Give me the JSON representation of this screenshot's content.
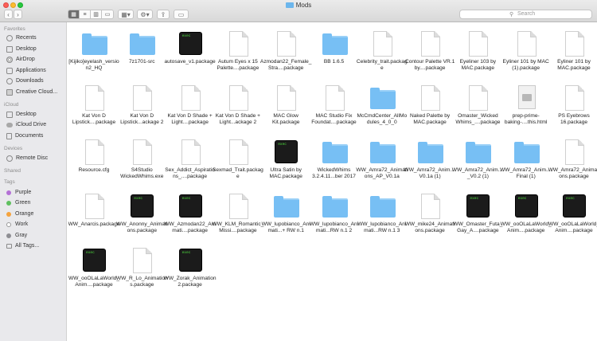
{
  "window": {
    "title": "Mods"
  },
  "toolbar": {
    "back_icon": "chevron-left-icon",
    "forward_icon": "chevron-right-icon",
    "view_modes": [
      "icon",
      "list",
      "columns",
      "gallery"
    ],
    "search_placeholder": "Search"
  },
  "sidebar": {
    "favorites_heading": "Favorites",
    "favorites": [
      {
        "label": "Recents",
        "icon": "clock-icon"
      },
      {
        "label": "Desktop",
        "icon": "desktop-icon"
      },
      {
        "label": "AirDrop",
        "icon": "airdrop-icon"
      },
      {
        "label": "Applications",
        "icon": "applications-icon"
      },
      {
        "label": "Downloads",
        "icon": "downloads-icon"
      },
      {
        "label": "Creative Cloud...",
        "icon": "creative-cloud-icon"
      }
    ],
    "icloud_heading": "iCloud",
    "icloud": [
      {
        "label": "Desktop",
        "icon": "desktop-icon"
      },
      {
        "label": "iCloud Drive",
        "icon": "cloud-icon"
      },
      {
        "label": "Documents",
        "icon": "document-icon"
      }
    ],
    "devices_heading": "Devices",
    "devices": [
      {
        "label": "Remote Disc",
        "icon": "disc-icon"
      }
    ],
    "shared_heading": "Shared",
    "tags_heading": "Tags",
    "tags": [
      {
        "label": "Purple",
        "color": "#b470d6"
      },
      {
        "label": "Green",
        "color": "#5fc05f"
      },
      {
        "label": "Orange",
        "color": "#f5a33d"
      },
      {
        "label": "Work",
        "color": "#ffffff"
      },
      {
        "label": "Gray",
        "color": "#8e8e93"
      },
      {
        "label": "All Tags...",
        "color": "none"
      }
    ]
  },
  "files": [
    {
      "name": "[Kijiko]eyelash_version2_HQ",
      "type": "folder"
    },
    {
      "name": "7z1701-src",
      "type": "folder"
    },
    {
      "name": "autosave_v1.package",
      "type": "exec"
    },
    {
      "name": "Autum Eyes x 15 Palette....package",
      "type": "doc"
    },
    {
      "name": "Azmodan22_Female_Stra....package",
      "type": "doc"
    },
    {
      "name": "BB 1.6.5",
      "type": "folder"
    },
    {
      "name": "Celebrity_trait.package",
      "type": "doc"
    },
    {
      "name": "Contour Palette VR.1 by....package",
      "type": "doc"
    },
    {
      "name": "Eyeliner 103 by MAC.package",
      "type": "doc"
    },
    {
      "name": "Eyliner 101 by MAC (1).package",
      "type": "doc"
    },
    {
      "name": "Eyliner 101 by MAC.package",
      "type": "doc"
    },
    {
      "name": "Kat Von D Lipstick....package",
      "type": "doc"
    },
    {
      "name": "Kat Von D Lipstick...ackage 2",
      "type": "doc"
    },
    {
      "name": "Kat Von D Shade + Light....package",
      "type": "doc"
    },
    {
      "name": "Kat Von D Shade + Light...ackage 2",
      "type": "doc"
    },
    {
      "name": "MAC Glow Kit.package",
      "type": "doc"
    },
    {
      "name": "MAC Studio Fix Foundat....package",
      "type": "doc"
    },
    {
      "name": "McCmdCenter_AllModules_4_0_0",
      "type": "folder"
    },
    {
      "name": "Naked Palette by MAC.package",
      "type": "doc"
    },
    {
      "name": "Omaster_Wicked Whims_....package",
      "type": "doc"
    },
    {
      "name": "prep-prime-baking-....this.html",
      "type": "html"
    },
    {
      "name": "PS Eyebrows 16.package",
      "type": "doc"
    },
    {
      "name": "Resource.cfg",
      "type": "doc"
    },
    {
      "name": "S4Studio WickedWhims.exe",
      "type": "doc"
    },
    {
      "name": "Sex_Addict_Aspirations_....package",
      "type": "doc"
    },
    {
      "name": "Sexmad_Trait.package",
      "type": "doc"
    },
    {
      "name": "Ultra Satin by MAC.package",
      "type": "exec"
    },
    {
      "name": "WickedWhims 3.2.4.11...ber 2017",
      "type": "folder"
    },
    {
      "name": "WW_Amra72_Animations_AP_V0.1a",
      "type": "folder"
    },
    {
      "name": "WW_Amra72_Anim....V0.1a (1)",
      "type": "folder"
    },
    {
      "name": "WW_Amra72_Anim...._V0.2 (1)",
      "type": "folder"
    },
    {
      "name": "WW_Amra72_Anim....Final (1)",
      "type": "folder"
    },
    {
      "name": "WW_Amra72_Animations.package",
      "type": "doc"
    },
    {
      "name": "WW_Anarcis.package",
      "type": "doc"
    },
    {
      "name": "WW_Anonny_Animations.package",
      "type": "exec"
    },
    {
      "name": "WW_Azmodan22_Animati....package",
      "type": "exec"
    },
    {
      "name": "WW_KLM_Romantic_Missi....package",
      "type": "doc"
    },
    {
      "name": "WW_lupobianco_Animati...+ RW n.1",
      "type": "folder"
    },
    {
      "name": "WW_lupobianco_Animati...RW n.1 2",
      "type": "folder"
    },
    {
      "name": "WW_lupobianco_Animati...RW n.1 3",
      "type": "folder"
    },
    {
      "name": "WW_mike24_Animations.package",
      "type": "doc"
    },
    {
      "name": "WW_Omaster_Futa_Gay_A....package",
      "type": "exec"
    },
    {
      "name": "WW_ooOLaLaWorld_Anim....package",
      "type": "exec"
    },
    {
      "name": "WW_ooOLaLaWorld_Anim....package",
      "type": "exec"
    },
    {
      "name": "WW_ooOLaLaWorld_Anim....package",
      "type": "exec"
    },
    {
      "name": "WW_R_Lo_Animations.package",
      "type": "doc"
    },
    {
      "name": "WW_Zorak_Animation 2.package",
      "type": "exec"
    }
  ],
  "exec_badge": "exec"
}
